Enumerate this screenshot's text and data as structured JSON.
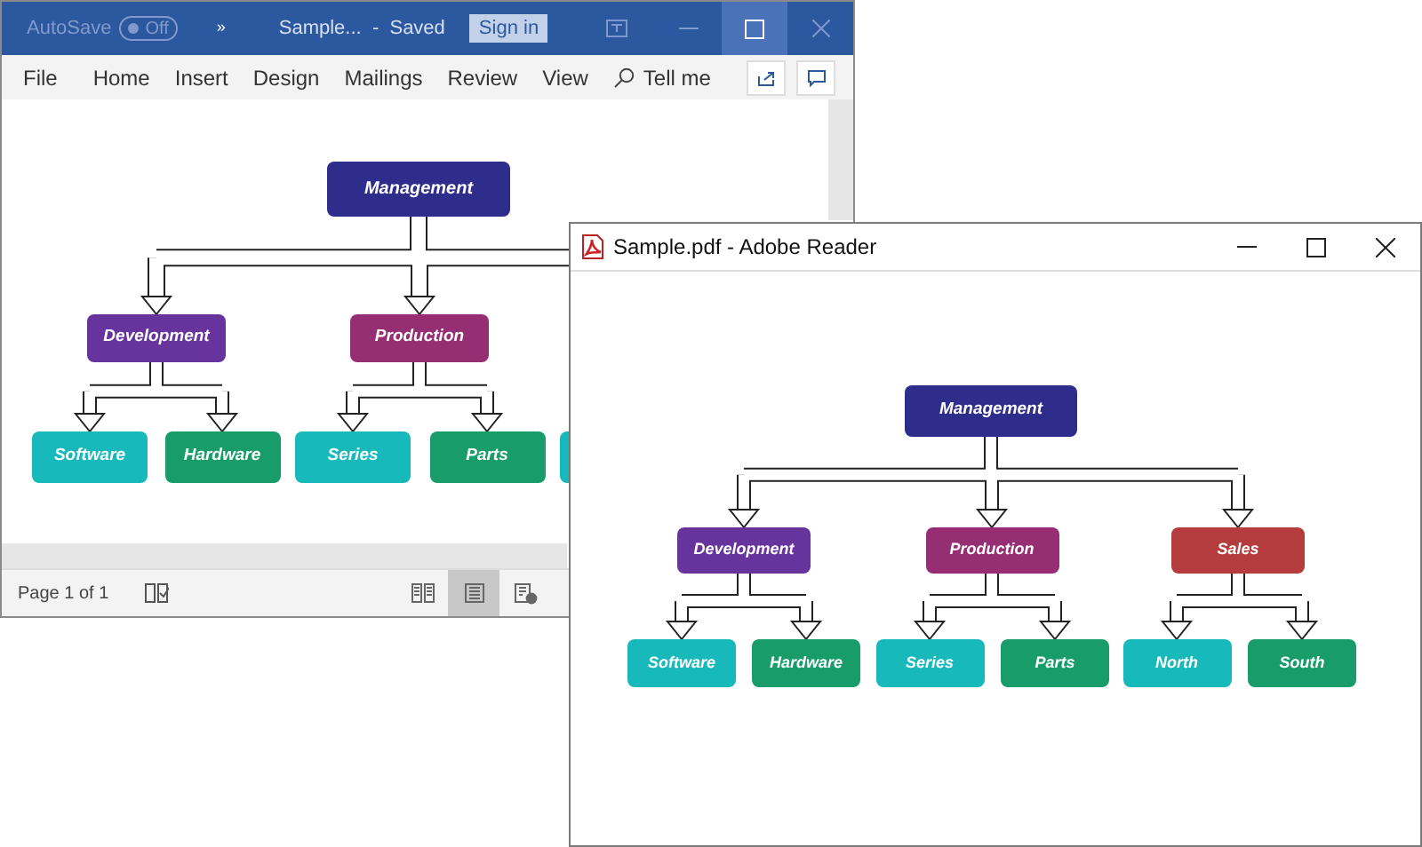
{
  "word_window": {
    "title_bar": {
      "autosave_label": "AutoSave",
      "autosave_toggle": {
        "label": "Off",
        "on": false
      },
      "more_glyph": "»",
      "document_title": "Sample...  -  Saved",
      "sign_in": "Sign in"
    },
    "ribbon_tabs": [
      {
        "label": "File"
      },
      {
        "label": "Home"
      },
      {
        "label": "Insert"
      },
      {
        "label": "Design"
      },
      {
        "label": "Mailings"
      },
      {
        "label": "Review"
      },
      {
        "label": "View"
      }
    ],
    "tell_me": "Tell me",
    "diagram": {
      "root": {
        "label": "Management",
        "color": "#2e2d8c",
        "children": [
          {
            "label": "Development",
            "color": "#67339c",
            "children": [
              {
                "label": "Software",
                "color": "#17b9bb"
              },
              {
                "label": "Hardware",
                "color": "#179c6a"
              }
            ]
          },
          {
            "label": "Production",
            "color": "#962e74",
            "children": [
              {
                "label": "Series",
                "color": "#17b9bb"
              },
              {
                "label": "Parts",
                "color": "#179c6a"
              }
            ]
          }
        ]
      },
      "partial_node": {
        "color": "#17b9bb"
      }
    },
    "status_bar": {
      "page": "Page 1 of 1",
      "views": [
        {
          "kind": "read",
          "selected": false
        },
        {
          "kind": "print",
          "selected": true
        },
        {
          "kind": "web",
          "selected": false
        }
      ]
    }
  },
  "reader_window": {
    "title": "Sample.pdf - Adobe Reader",
    "diagram": {
      "root": {
        "label": "Management",
        "color": "#2e2d8c",
        "children": [
          {
            "label": "Development",
            "color": "#67339c",
            "children": [
              {
                "label": "Software",
                "color": "#17b9bb"
              },
              {
                "label": "Hardware",
                "color": "#179c6a"
              }
            ]
          },
          {
            "label": "Production",
            "color": "#962e74",
            "children": [
              {
                "label": "Series",
                "color": "#17b9bb"
              },
              {
                "label": "Parts",
                "color": "#179c6a"
              }
            ]
          },
          {
            "label": "Sales",
            "color": "#b53c3c",
            "children": [
              {
                "label": "North",
                "color": "#17b9bb"
              },
              {
                "label": "South",
                "color": "#179c6a"
              }
            ]
          }
        ]
      }
    }
  }
}
